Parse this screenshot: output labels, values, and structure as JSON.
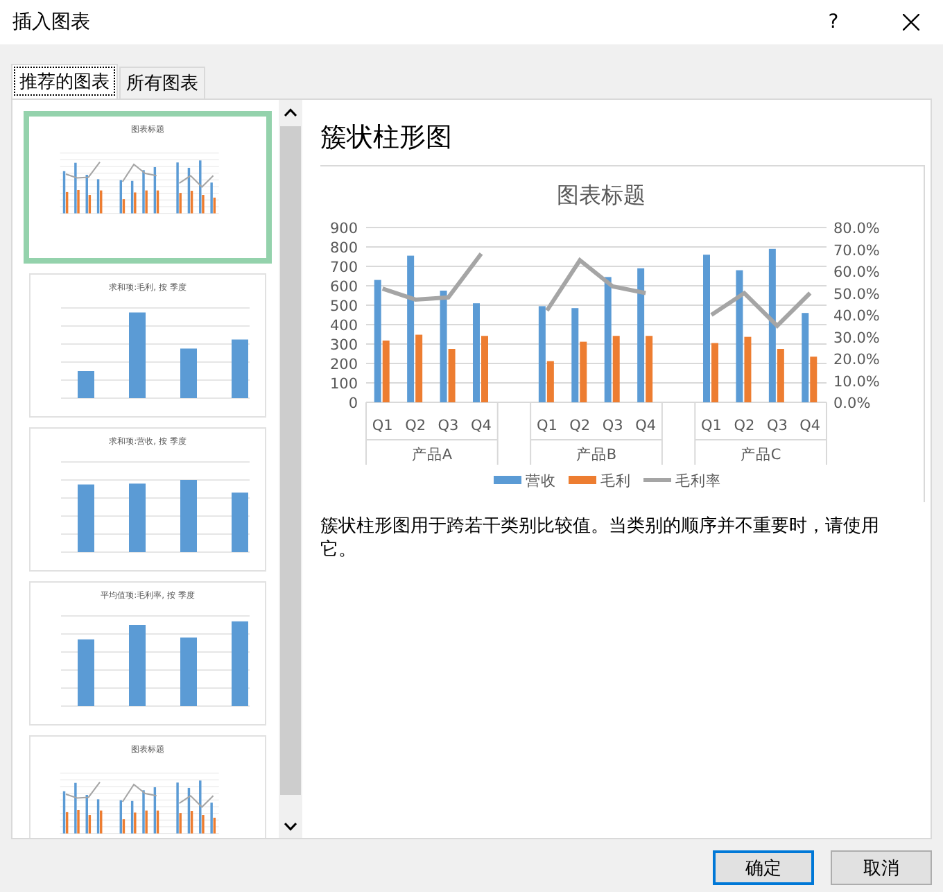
{
  "window": {
    "title": "插入图表",
    "help": "?"
  },
  "tabs": [
    {
      "label": "推荐的图表",
      "selected": true
    },
    {
      "label": "所有图表",
      "selected": false
    }
  ],
  "thumbnails": [
    {
      "kind": "combo",
      "title": "图表标题",
      "selected": true
    },
    {
      "kind": "bar",
      "title": "求和项:毛利, 按 季度",
      "selected": false
    },
    {
      "kind": "bar",
      "title": "求和项:营收, 按 季度",
      "selected": false
    },
    {
      "kind": "bar",
      "title": "平均值项:毛利率, 按 季度",
      "selected": false
    },
    {
      "kind": "combo",
      "title": "图表标题",
      "selected": false
    }
  ],
  "preview": {
    "heading": "簇状柱形图",
    "chart_data": {
      "type": "bar",
      "title": "图表标题",
      "categories": [
        "Q1",
        "Q2",
        "Q3",
        "Q4",
        "Q1",
        "Q2",
        "Q3",
        "Q4",
        "Q1",
        "Q2",
        "Q3",
        "Q4"
      ],
      "annotations": [
        {
          "text": "产品A"
        },
        {
          "text": "产品B"
        },
        {
          "text": "产品C"
        }
      ],
      "series": [
        {
          "name": "营收",
          "color": "#5b9bd5",
          "values": [
            630,
            755,
            575,
            510,
            495,
            485,
            645,
            690,
            760,
            680,
            790,
            460
          ]
        },
        {
          "name": "毛利",
          "color": "#ed7d31",
          "values": [
            318,
            348,
            275,
            342,
            212,
            312,
            342,
            342,
            305,
            337,
            275,
            235
          ]
        },
        {
          "name": "毛利率",
          "color": "#a5a5a5",
          "type": "line",
          "axis": "y2",
          "values": [
            0.52,
            0.47,
            0.48,
            0.68,
            0.42,
            0.65,
            0.53,
            0.5,
            0.4,
            0.5,
            0.35,
            0.5
          ]
        }
      ],
      "grid": true,
      "legend": "bottom",
      "ylim": [
        0,
        900
      ],
      "yticks": [
        0,
        100,
        200,
        300,
        400,
        500,
        600,
        700,
        800,
        900
      ],
      "y2lim": [
        0,
        0.8
      ],
      "y2ticks": [
        {
          "value": 0,
          "label": "0.0%"
        },
        {
          "value": 0.1,
          "label": "10.0%"
        },
        {
          "value": 0.2,
          "label": "20.0%"
        },
        {
          "value": 0.3,
          "label": "30.0%"
        },
        {
          "value": 0.4,
          "label": "40.0%"
        },
        {
          "value": 0.5,
          "label": "50.0%"
        },
        {
          "value": 0.6,
          "label": "60.0%"
        },
        {
          "value": 0.7,
          "label": "70.0%"
        },
        {
          "value": 0.8,
          "label": "80.0%"
        }
      ]
    },
    "description": "簇状柱形图用于跨若干类别比较值。当类别的顺序并不重要时，请使用它。"
  },
  "buttons": [
    {
      "label": "确定",
      "default": true
    },
    {
      "label": "取消",
      "default": false
    }
  ]
}
